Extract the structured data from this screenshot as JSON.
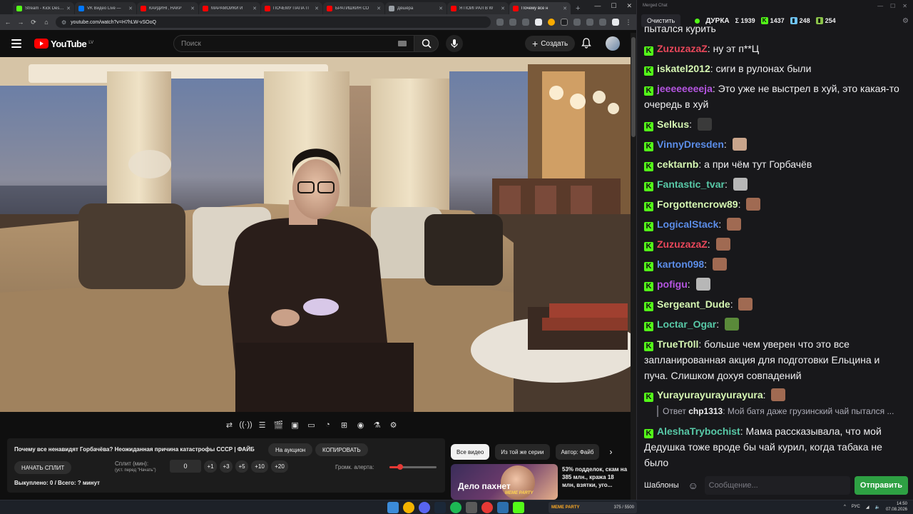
{
  "browser": {
    "tabs": [
      {
        "label": "Stream - Kick Desktop",
        "color": "#53fc18"
      },
      {
        "label": "VK Видео Live —",
        "color": "#0077ff"
      },
      {
        "label": "КАРДИНГ, НАКР",
        "color": "#ff0000"
      },
      {
        "label": "МАРАМОЙКИ И",
        "color": "#ff0000"
      },
      {
        "label": "ПОЧЕМУ ПАПА П",
        "color": "#ff0000"
      },
      {
        "label": "БРАТИШКИН СО",
        "color": "#ff0000"
      },
      {
        "label": "Дёшёра",
        "color": "#9aa0a6"
      },
      {
        "label": "Я ПОИГРАЛ В W",
        "color": "#ff0000"
      },
      {
        "label": "Почему все н",
        "color": "#ff0000"
      }
    ],
    "url": "youtube.com/watch?v=H7hLW-vSOoQ"
  },
  "youtube": {
    "logo_word": "YouTube",
    "country_code": "LV",
    "search_placeholder": "Поиск",
    "create_label": "Создать"
  },
  "info_panel": {
    "title": "Почему все ненавидят Горбачёва? Неожиданная причина катастрофы СССР | ФАЙБ",
    "auction_label": "На аукцион",
    "copy_label": "КОПИРОВАТЬ",
    "start_split_label": "НАЧАТЬ СПЛИТ",
    "split_label": "Сплит (мин):",
    "split_hint": "(уст. перед \"Начать\")",
    "split_value": "0",
    "step_buttons": [
      "+1",
      "+3",
      "+5",
      "+10",
      "+20"
    ],
    "alert_volume_label": "Громк. алерта:",
    "alert_volume_fraction": 0.22,
    "status": "Выкуплено: 0 / Всего: ? минут"
  },
  "chips": [
    "Все видео",
    "Из той же серии",
    "Автор: Файб"
  ],
  "recommendation": {
    "thumb_title": "Дело пахнет",
    "thumb_badge": "MEME PARTY",
    "text": "53% подделок, скам на 385 млн., кража 18 млн, взятки, уго..."
  },
  "chat": {
    "window_title": "Merged Chat",
    "clear_label": "Очистить",
    "channel": "ДУРКА",
    "stats": {
      "sum": "Σ 1939",
      "signal": "1437",
      "kick_a": "248",
      "kick_b": "254"
    },
    "top_fragment": "пытался курить",
    "messages": [
      {
        "user": "ZuzuzazaZ",
        "color": "#e8475a",
        "text": "ну эт п**Ц",
        "emote": ""
      },
      {
        "user": "iskatel2012",
        "color": "#d6f7b3",
        "text": "сиги в рулонах были",
        "emote": ""
      },
      {
        "user": "jeeeeeeeeja",
        "color": "#b455e0",
        "text": "Это уже не выстрел в хуй, это какая-то очередь в хуй",
        "emote": ""
      },
      {
        "user": "Selkus",
        "color": "#d6f7b3",
        "text": "",
        "emote": "#3a3a3a"
      },
      {
        "user": "VinnyDresden",
        "color": "#5b8de8",
        "text": "",
        "emote": "#c9a58c"
      },
      {
        "user": "cektarnb",
        "color": "#d6f7b3",
        "text": "а при чём тут Горбачёв",
        "emote": ""
      },
      {
        "user": "Fantastic_tvar",
        "color": "#58c9a7",
        "text": "",
        "emote": "#b7b7b7"
      },
      {
        "user": "Forgottencrow89",
        "color": "#d6f7b3",
        "text": "",
        "emote": "#a06a52"
      },
      {
        "user": "LogicalStack",
        "color": "#5b8de8",
        "text": "",
        "emote": "#a06a52"
      },
      {
        "user": "ZuzuzazaZ",
        "color": "#e8475a",
        "text": "",
        "emote": "#a06a52"
      },
      {
        "user": "karton098",
        "color": "#5b8de8",
        "text": "",
        "emote": "#a06a52"
      },
      {
        "user": "pofigu",
        "color": "#b455e0",
        "text": "",
        "emote": "#b7b7b7"
      },
      {
        "user": "Sergeant_Dude",
        "color": "#d6f7b3",
        "text": "",
        "emote": "#a06a52"
      },
      {
        "user": "Loctar_Ogar",
        "color": "#58c9a7",
        "text": "",
        "emote": "#5a8a3a"
      },
      {
        "user": "TrueTr0ll",
        "color": "#d6f7b3",
        "text": "больше чем уверен что это все запланированная акция для подготовки Ельцина и пуча. Слишком дохуя совпадений",
        "emote": ""
      },
      {
        "user": "Yurayurayurayurayura",
        "color": "#d6f7b3",
        "text": "",
        "emote": "#a06a52"
      },
      {
        "user": "AleshaTrybochist",
        "color": "#58c9a7",
        "text": "Мама рассказывала, что мой Дедушка тоже вроде бы чай курил, когда табака не было",
        "emote": ""
      }
    ],
    "reply": {
      "prefix": "Ответ",
      "user": "chp1313",
      "text": "Мой батя даже грузинский чай пытался ..."
    },
    "templates_label": "Шаблоны",
    "input_placeholder": "Сообщение...",
    "send_label": "Отправить"
  },
  "taskbar": {
    "widget_text": "375 / 5500",
    "widget_brand": "MEME PARTY",
    "lang": "РУС",
    "time": "14:50",
    "date": "07.08.2026"
  }
}
